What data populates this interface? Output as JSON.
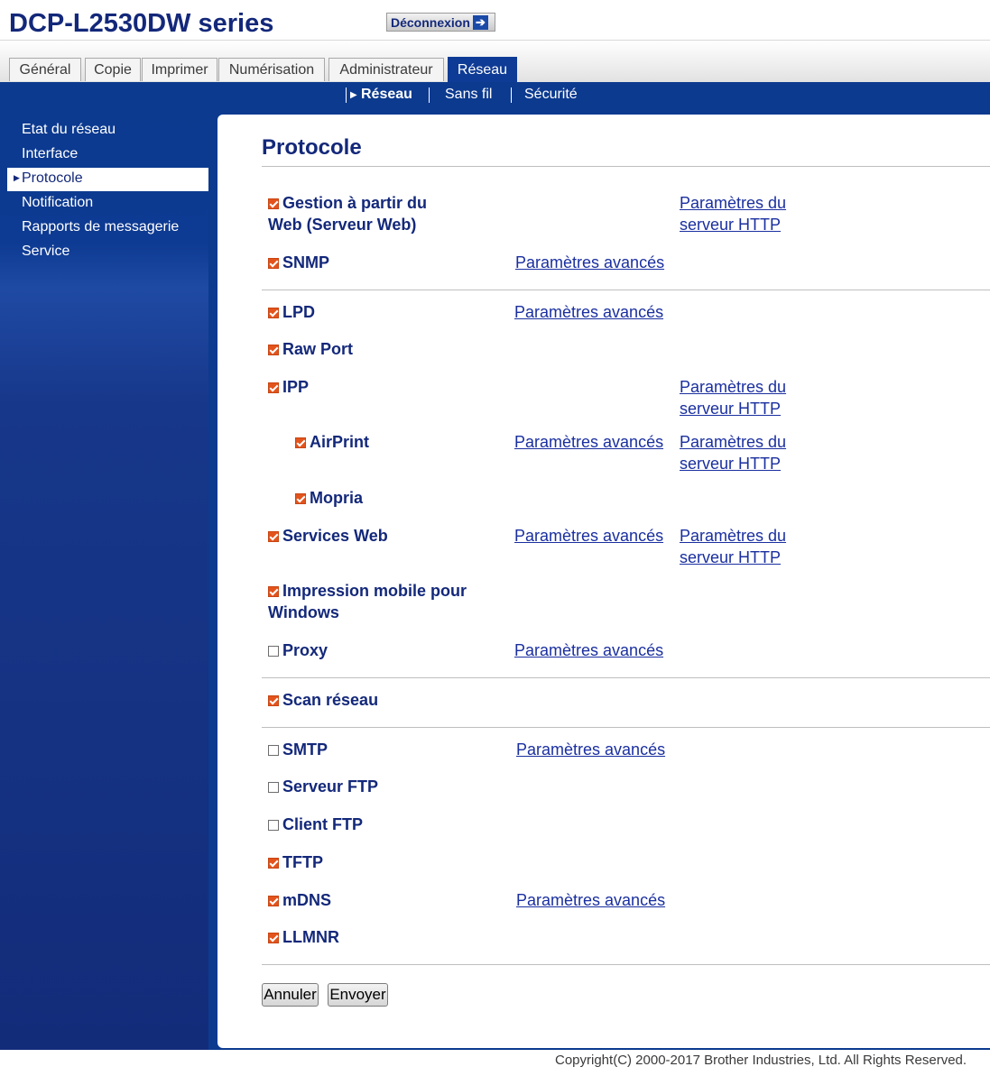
{
  "header": {
    "model": "DCP-L2530DW series",
    "logout_label": "Déconnexion",
    "logout_icon": "arrow-right-icon"
  },
  "tabs": [
    {
      "label": "Général"
    },
    {
      "label": "Copie"
    },
    {
      "label": "Imprimer"
    },
    {
      "label": "Numérisation"
    },
    {
      "label": "Administrateur"
    },
    {
      "label": "Réseau",
      "active": true
    }
  ],
  "subnav": [
    {
      "label": "Réseau",
      "active": true
    },
    {
      "label": "Sans fil"
    },
    {
      "label": "Sécurité"
    }
  ],
  "leftnav": [
    {
      "label": "Etat du réseau"
    },
    {
      "label": "Interface"
    },
    {
      "label": "Protocole",
      "active": true
    },
    {
      "label": "Notification"
    },
    {
      "label": "Rapports de messagerie"
    },
    {
      "label": "Service"
    }
  ],
  "page_title": "Protocole",
  "protocols": {
    "web": {
      "label_line1": "Gestion à partir du",
      "label_line2": "Web (Serveur Web)",
      "checked": true,
      "http_line1": "Paramètres du",
      "http_line2": "serveur HTTP"
    },
    "snmp": {
      "label": "SNMP",
      "checked": true,
      "advanced": "Paramètres avancés"
    },
    "lpd": {
      "label": "LPD",
      "checked": true,
      "advanced": "Paramètres avancés"
    },
    "raw_port": {
      "label": "Raw Port",
      "checked": true
    },
    "ipp": {
      "label": "IPP",
      "checked": true,
      "http_line1": "Paramètres du",
      "http_line2": "serveur HTTP"
    },
    "airprint": {
      "label": "AirPrint",
      "checked": true,
      "advanced": "Paramètres avancés",
      "http_line1": "Paramètres du",
      "http_line2": "serveur HTTP"
    },
    "mopria": {
      "label": "Mopria",
      "checked": true
    },
    "web_services": {
      "label": "Services Web",
      "checked": true,
      "advanced": "Paramètres avancés",
      "http_line1": "Paramètres du",
      "http_line2": "serveur HTTP"
    },
    "mobile_print": {
      "label_line1": "Impression mobile pour",
      "label_line2": "Windows",
      "checked": true
    },
    "proxy": {
      "label": "Proxy",
      "checked": false,
      "advanced": "Paramètres avancés"
    },
    "scan": {
      "label": "Scan réseau",
      "checked": true
    },
    "smtp": {
      "label": "SMTP",
      "checked": false,
      "advanced": "Paramètres avancés"
    },
    "ftp_server": {
      "label": "Serveur FTP",
      "checked": false
    },
    "ftp_client": {
      "label": "Client FTP",
      "checked": false
    },
    "tftp": {
      "label": "TFTP",
      "checked": true
    },
    "mdns": {
      "label": "mDNS",
      "checked": true,
      "advanced": "Paramètres avancés"
    },
    "llmnr": {
      "label": "LLMNR",
      "checked": true
    }
  },
  "buttons": {
    "cancel": "Annuler",
    "submit": "Envoyer"
  },
  "footer": {
    "copyright": "Copyright(C) 2000-2017 Brother Industries, Ltd. All Rights Reserved."
  },
  "colors": {
    "brand_blue": "#0c3a8f",
    "title_blue": "#13287a",
    "check_orange": "#e2541c",
    "link_blue": "#1a2fa0"
  }
}
